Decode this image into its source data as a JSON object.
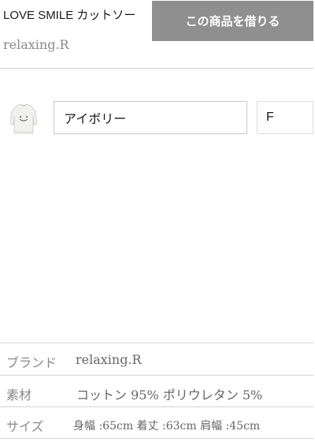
{
  "product": {
    "title": "LOVE SMILE カットソー",
    "brand": "relaxing.R"
  },
  "actions": {
    "rent_label": "この商品を借りる"
  },
  "variant": {
    "thumbnail_icon": "sweater-thumbnail",
    "color_value": "アイボリー",
    "size_value": "F"
  },
  "specs": [
    {
      "label": "ブランド",
      "value": "relaxing.R"
    },
    {
      "label": "素材",
      "value": "コットン 95% ポリウレタン 5%"
    },
    {
      "label": "サイズ",
      "value": "身幅 :65cm 着丈 :63cm 肩幅 :45cm"
    }
  ],
  "colors": {
    "button_bg": "#8f8f8f",
    "divider": "#d4d4d4",
    "muted_text": "#8a8a8a"
  }
}
